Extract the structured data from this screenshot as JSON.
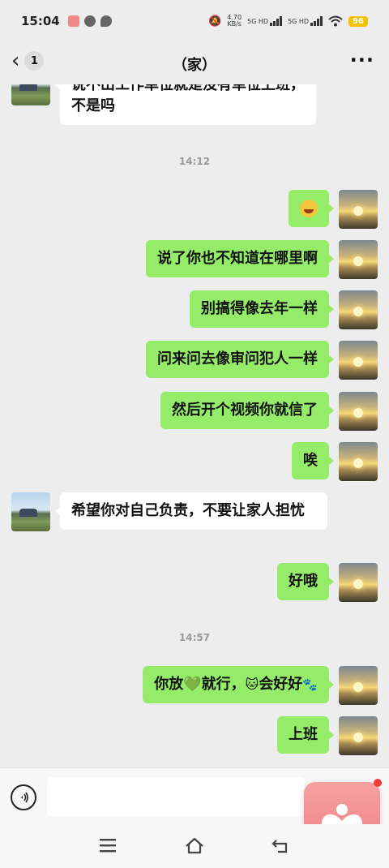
{
  "status_bar": {
    "time": "15:04",
    "net_speed": "4.70",
    "net_unit": "KB/s",
    "sig1": "5G HD",
    "sig2": "5G HD",
    "battery": "96"
  },
  "header": {
    "unread": "1",
    "title": "（家）",
    "more": "···"
  },
  "messages": [
    {
      "from": "them",
      "text": "说不出工作单位就是没有单位上班，不是吗"
    },
    {
      "timestamp": "14:12"
    },
    {
      "from": "me",
      "text": ""
    },
    {
      "from": "me",
      "text": "说了你也不知道在哪里啊"
    },
    {
      "from": "me",
      "text": "别搞得像去年一样"
    },
    {
      "from": "me",
      "text": "问来问去像审问犯人一样"
    },
    {
      "from": "me",
      "text": "然后开个视频你就信了"
    },
    {
      "from": "me",
      "text": "唉"
    },
    {
      "from": "them",
      "text": "希望你对自己负责，不要让家人担忧"
    },
    {
      "from": "me",
      "text": "好哦"
    },
    {
      "timestamp": "14:57"
    },
    {
      "from": "me",
      "text_parts": [
        "你放",
        "就行，",
        "会好好"
      ]
    },
    {
      "from": "me",
      "text": "上班"
    }
  ],
  "icons": {
    "emoji_face": "laughing-face-emoji",
    "heart_emoji": "green-heart-emoji",
    "cat_emoji": "cat-face-emoji",
    "paw_emoji": "paw-prints-emoji"
  },
  "colors": {
    "my_bubble": "#95ec69",
    "their_bubble": "#ffffff",
    "background": "#ededed",
    "floating_button": "#ee7f84"
  }
}
